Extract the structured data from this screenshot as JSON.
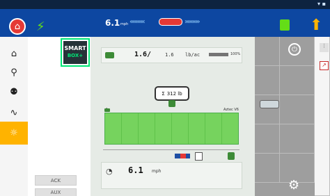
{
  "colors": {
    "header_bg": "#0d47a1",
    "status_bg": "#0d2340",
    "main_bg": "#e6ebe6",
    "boom_green": "#76d35e",
    "nav_active": "#ffb300",
    "grid_gray": "#9e9e9e"
  },
  "header": {
    "speed": "6.1",
    "speed_unit": "mph",
    "steer_left": "«««««",
    "steer_right": "»»»»»",
    "icons": {
      "home": "home-icon",
      "gps": "satellite-icon",
      "tractor": "tractor-icon",
      "navigation": "nav-arrow-icon"
    }
  },
  "left_nav": {
    "items": [
      {
        "icon": "home-icon",
        "glyph": "⌂"
      },
      {
        "icon": "run-icon",
        "glyph": "⚲"
      },
      {
        "icon": "operator-icon",
        "glyph": "⚉"
      },
      {
        "icon": "heartbeat-icon",
        "glyph": "∿"
      },
      {
        "icon": "sun-icon",
        "glyph": "☼"
      }
    ]
  },
  "side_panel": {
    "smartbox": {
      "line1": "SMART",
      "line2": "BOX+"
    },
    "buttons": [
      {
        "label": "ACK"
      },
      {
        "label": "AUX"
      }
    ]
  },
  "main": {
    "rate_row": {
      "target": "1.6/",
      "actual": "1.6",
      "unit": "lb/ac",
      "percent": "100%",
      "bar_level": 1.0
    },
    "total": {
      "sigma": "Σ",
      "value": "312 lb"
    },
    "boom": {
      "left_label": "1",
      "right_label": "Aztec V6",
      "sections": 8
    },
    "speed_row": {
      "value": "6.1",
      "unit": "mph"
    }
  },
  "right_panel": {
    "power": "⏻",
    "gear": "⚙",
    "edge_buttons": [
      "⋮",
      "↗"
    ]
  }
}
